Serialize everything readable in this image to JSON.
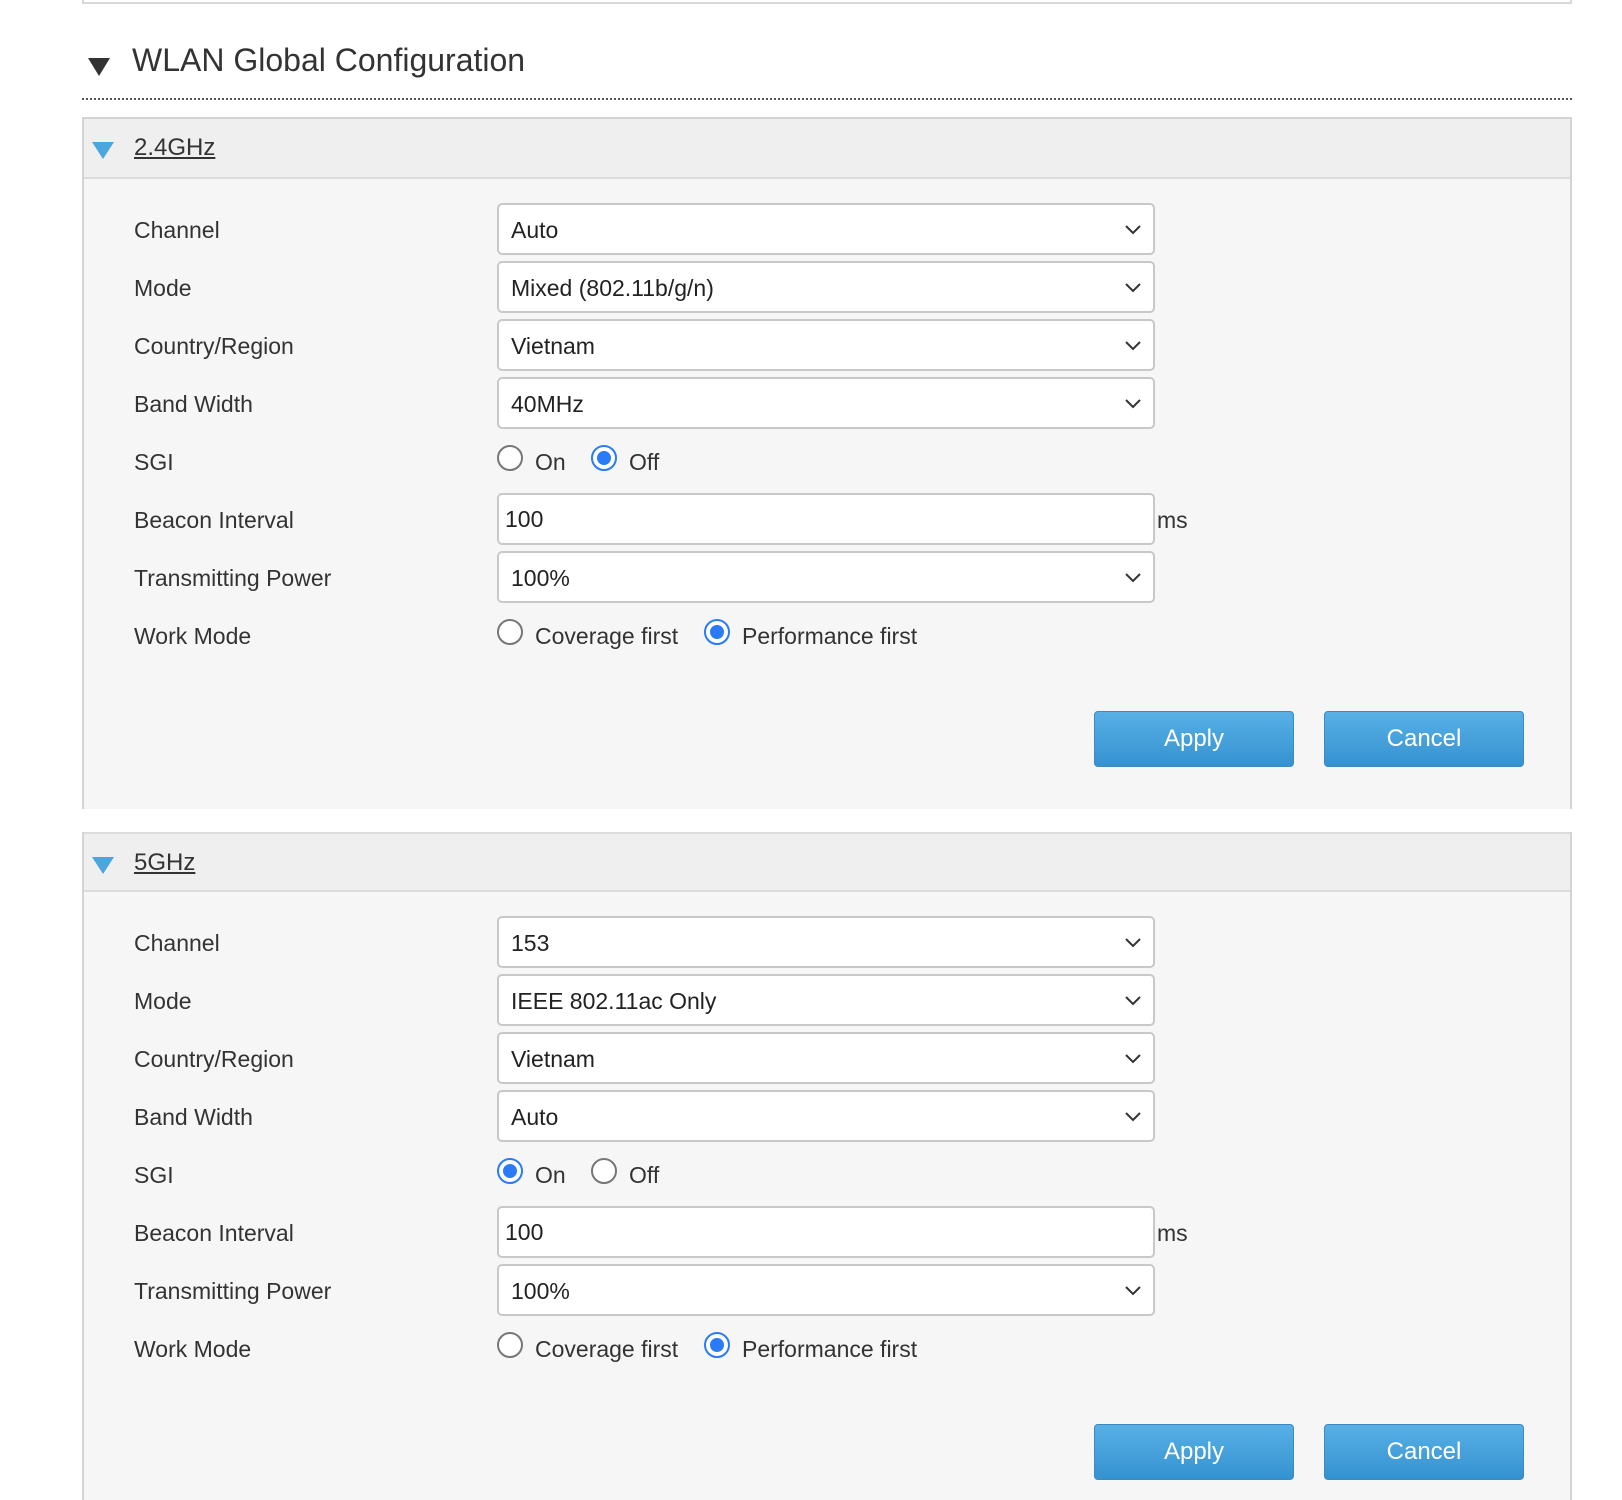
{
  "section": {
    "title": "WLAN Global Configuration"
  },
  "bands": [
    {
      "name": "2.4GHz",
      "labels": {
        "channel": "Channel",
        "mode": "Mode",
        "country": "Country/Region",
        "bandwidth": "Band Width",
        "sgi": "SGI",
        "beacon": "Beacon Interval",
        "power": "Transmitting Power",
        "work_mode": "Work Mode"
      },
      "channel": "Auto",
      "mode": "Mixed (802.11b/g/n)",
      "country": "Vietnam",
      "bandwidth": "40MHz",
      "sgi": {
        "on_label": "On",
        "off_label": "Off",
        "selected": "off"
      },
      "beacon_interval": "100",
      "beacon_unit": "ms",
      "power": "100%",
      "work_mode": {
        "coverage_label": "Coverage first",
        "performance_label": "Performance first",
        "selected": "performance"
      },
      "apply_label": "Apply",
      "cancel_label": "Cancel"
    },
    {
      "name": "5GHz",
      "labels": {
        "channel": "Channel",
        "mode": "Mode",
        "country": "Country/Region",
        "bandwidth": "Band Width",
        "sgi": "SGI",
        "beacon": "Beacon Interval",
        "power": "Transmitting Power",
        "work_mode": "Work Mode"
      },
      "channel": "153",
      "mode": "IEEE 802.11ac Only",
      "country": "Vietnam",
      "bandwidth": "Auto",
      "sgi": {
        "on_label": "On",
        "off_label": "Off",
        "selected": "on"
      },
      "beacon_interval": "100",
      "beacon_unit": "ms",
      "power": "100%",
      "work_mode": {
        "coverage_label": "Coverage first",
        "performance_label": "Performance first",
        "selected": "performance"
      },
      "apply_label": "Apply",
      "cancel_label": "Cancel"
    }
  ],
  "colors": {
    "accent_blue": "#4aa6dc",
    "radio_blue": "#2a7bf5",
    "button_blue": "#3592d0"
  }
}
